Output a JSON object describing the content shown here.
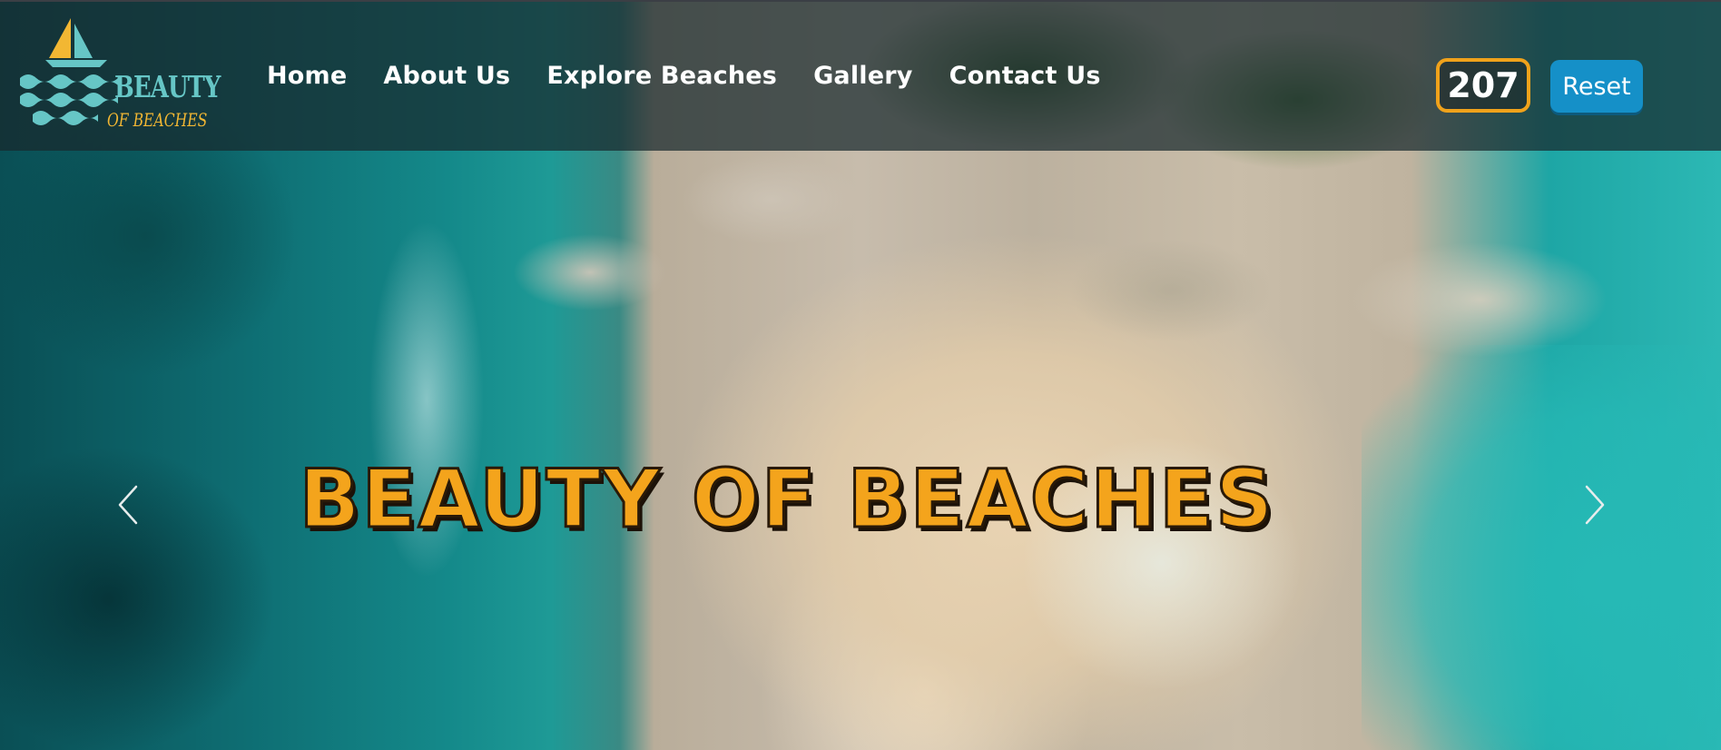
{
  "logo": {
    "line1": "BEAUTY",
    "line2": "OF BEACHES"
  },
  "nav": {
    "items": [
      {
        "label": "Home"
      },
      {
        "label": "About Us"
      },
      {
        "label": "Explore Beaches"
      },
      {
        "label": "Gallery"
      },
      {
        "label": "Contact Us"
      }
    ]
  },
  "counter": {
    "value": "207"
  },
  "reset": {
    "label": "Reset"
  },
  "hero": {
    "title": "BEAUTY OF BEACHES"
  },
  "carousel": {
    "prev_icon": "chevron-left-icon",
    "next_icon": "chevron-right-icon"
  },
  "colors": {
    "accent": "#f4a41c",
    "button": "#1590c8",
    "badge_border": "#f0a21b",
    "logo_teal": "#66c6c6",
    "navbar_bg": "rgba(24,40,44,0.72)"
  }
}
